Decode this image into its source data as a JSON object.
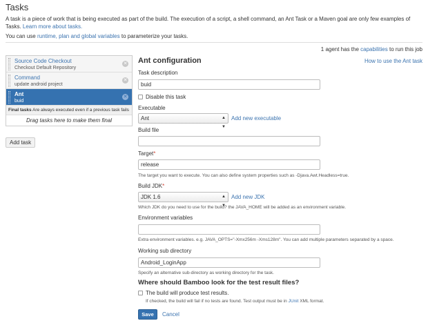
{
  "page": {
    "title": "Tasks",
    "intro_text": "A task is a piece of work that is being executed as part of the build. The execution of a script, a shell command, an Ant Task or a Maven goal are only few examples of Tasks.",
    "learn_more_link": "Learn more about tasks.",
    "variables_prefix": "You can use",
    "variables_link": "runtime, plan and global variables",
    "variables_suffix": "to parameterize your tasks.",
    "agents_prefix": "1 agent has the",
    "agents_link": "capabilities",
    "agents_suffix": "to run this job"
  },
  "sidebar": {
    "tasks": [
      {
        "name": "Source Code Checkout",
        "description": "Checkout Default Repository",
        "selected": false
      },
      {
        "name": "Command",
        "description": "update android project",
        "selected": false
      },
      {
        "name": "Ant",
        "description": "buid",
        "selected": true
      }
    ],
    "final_tasks_label": "Final tasks",
    "final_tasks_note": "Are always executed even if a previous task fails",
    "drop_zone_text": "Drag tasks here to make them final",
    "add_task_label": "Add task"
  },
  "form": {
    "title": "Ant configuration",
    "help_link": "How to use the Ant task",
    "task_description_label": "Task description",
    "task_description_value": "buid",
    "disable_label": "Disable this task",
    "disable_checked": false,
    "executable_label": "Executable",
    "executable_value": "Ant",
    "add_executable_link": "Add new executable",
    "build_file_label": "Build file",
    "build_file_value": "",
    "target_label": "Target",
    "target_value": "release",
    "target_help": "The target you want to execute. You can also define system properties such as -Djava.Awt.Headless=true.",
    "build_jdk_label": "Build JDK",
    "build_jdk_value": "JDK 1.6",
    "add_jdk_link": "Add new JDK",
    "build_jdk_help": "Which JDK do you need to use for the build? the JAVA_HOME will be added as an environment variable.",
    "env_vars_label": "Environment variables",
    "env_vars_value": "",
    "env_vars_help": "Extra environment variables. e.g. JAVA_OPTS=\"-Xmx256m -Xms128m\". You can add multiple parameters separated by a space.",
    "working_dir_label": "Working sub directory",
    "working_dir_value": "Android_LoginApp",
    "working_dir_help": "Specify an alternative sub-directory as working directory for the task.",
    "test_results_heading": "Where should Bamboo look for the test result files?",
    "test_results_label": "The build will produce test results.",
    "test_results_checked": false,
    "test_results_help_prefix": "If checked, the build will fail if no tests are found. Test output must be in",
    "test_results_help_link": "JUnit",
    "test_results_help_suffix": "XML format.",
    "save_label": "Save",
    "cancel_label": "Cancel",
    "required_mark": "*"
  },
  "colors": {
    "link": "#3b73af",
    "selected_task_bg": "#3572b0",
    "save_button_bg": "#3572b0",
    "required": "#d04437"
  }
}
